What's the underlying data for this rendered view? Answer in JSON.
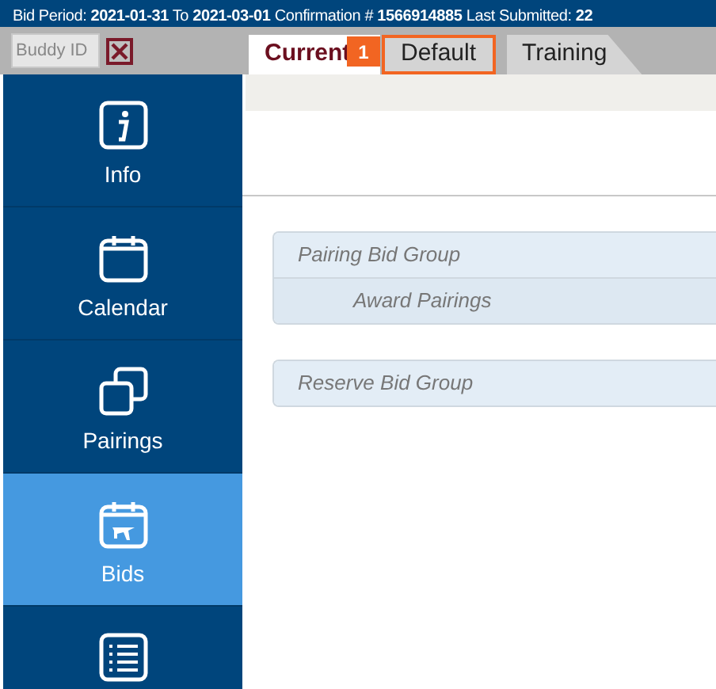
{
  "header": {
    "text": "Bid Period: **2021-01-31** To **2021-03-01** Confirmation # **1566914885** Last Submitted: **22**"
  },
  "buddy_field": {
    "placeholder": "Buddy ID"
  },
  "tabs": [
    {
      "label": "Current",
      "selected": true,
      "badge": "1"
    },
    {
      "label": "Default",
      "selected": false,
      "highlighted": true
    },
    {
      "label": "Training",
      "selected": false
    }
  ],
  "sidebar": {
    "items": [
      {
        "label": "Info",
        "selected": false
      },
      {
        "label": "Calendar",
        "selected": false
      },
      {
        "label": "Pairings",
        "selected": false
      },
      {
        "label": "Bids",
        "selected": true
      },
      {
        "selected": false
      }
    ]
  },
  "groups": [
    {
      "title": "Pairing Bid Group",
      "children": [
        {
          "title": "Award Pairings"
        }
      ]
    },
    {
      "title": "Reserve Bid Group"
    }
  ]
}
